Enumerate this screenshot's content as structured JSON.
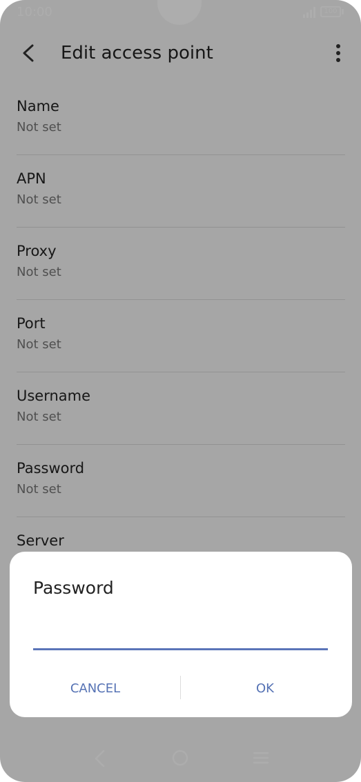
{
  "status_bar": {
    "time": "10:00",
    "battery": "100"
  },
  "app_bar": {
    "title": "Edit access point"
  },
  "settings": [
    {
      "title": "Name",
      "value": "Not set"
    },
    {
      "title": "APN",
      "value": "Not set"
    },
    {
      "title": "Proxy",
      "value": "Not set"
    },
    {
      "title": "Port",
      "value": "Not set"
    },
    {
      "title": "Username",
      "value": "Not set"
    },
    {
      "title": "Password",
      "value": "Not set"
    },
    {
      "title": "Server",
      "value": ""
    }
  ],
  "dialog": {
    "title": "Password",
    "input_value": "",
    "cancel_label": "CANCEL",
    "ok_label": "OK"
  },
  "colors": {
    "accent": "#5572b4",
    "scrim": "#000000"
  },
  "icons": {
    "back": "arrow-left-icon",
    "more": "more-vert-icon",
    "nav_back": "chevron-left-icon",
    "nav_home": "circle-icon",
    "nav_menu": "menu-icon"
  }
}
